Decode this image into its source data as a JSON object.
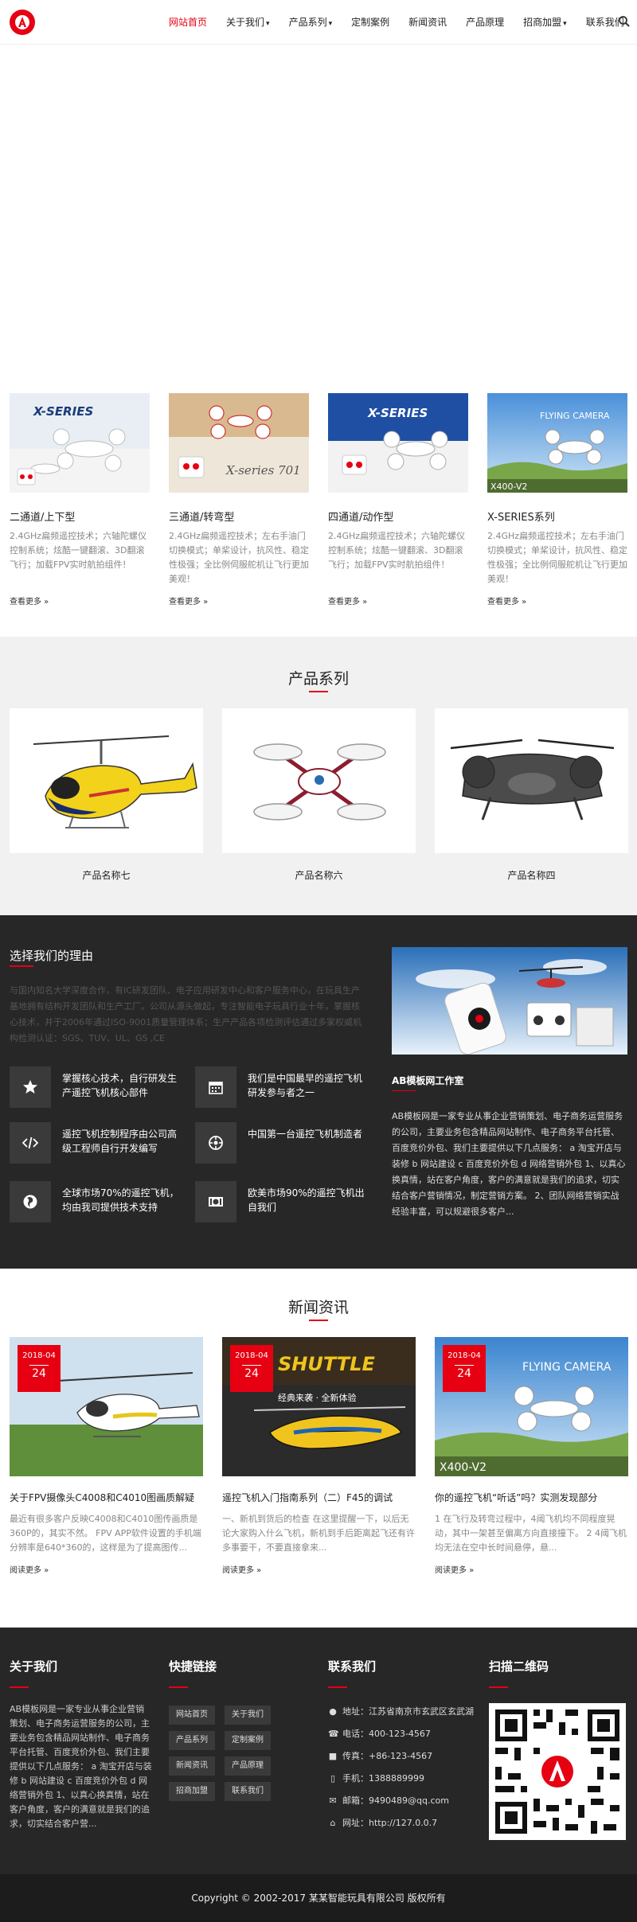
{
  "brand": {
    "logo_letter": "A",
    "accent": "#e60012"
  },
  "nav": {
    "items": [
      {
        "label": "网站首页",
        "active": true,
        "dropdown": false
      },
      {
        "label": "关于我们",
        "active": false,
        "dropdown": true
      },
      {
        "label": "产品系列",
        "active": false,
        "dropdown": true
      },
      {
        "label": "定制案例",
        "active": false,
        "dropdown": false
      },
      {
        "label": "新闻资讯",
        "active": false,
        "dropdown": false
      },
      {
        "label": "产品原理",
        "active": false,
        "dropdown": false
      },
      {
        "label": "招商加盟",
        "active": false,
        "dropdown": true
      },
      {
        "label": "联系我们",
        "active": false,
        "dropdown": false
      }
    ],
    "dropdown_caret": "▾"
  },
  "features": [
    {
      "title": "二通道/上下型",
      "desc": "2.4GHz扁频遥控技术；六轴陀螺仪控制系统；炫酷一键翻滚、3D翻滚飞行；加载FPV实时航拍组件！",
      "more": "查看更多 »",
      "img_text": "X-SERIES"
    },
    {
      "title": "三通道/转弯型",
      "desc": "2.4GHz扁频遥控技术；左右手油门切换模式；单桨设计，抗风性、稳定性极强；全比例伺服舵机让飞行更加美观！",
      "more": "查看更多 »",
      "img_text": "X-series 701"
    },
    {
      "title": "四通道/动作型",
      "desc": "2.4GHz扁频遥控技术；六轴陀螺仪控制系统；炫酷一键翻滚、3D翻滚飞行；加载FPV实时航拍组件！",
      "more": "查看更多 »",
      "img_text": "X-SERIES"
    },
    {
      "title": "X-SERIES系列",
      "desc": "2.4GHz扁频遥控技术；左右手油门切换模式；单桨设计，抗风性、稳定性极强；全比例伺服舵机让飞行更加美观！",
      "more": "查看更多 »",
      "img_text": "FLYING CAMERA",
      "img_text2": "X400-V2"
    }
  ],
  "products": {
    "title": "产品系列",
    "items": [
      {
        "name": "产品名称七"
      },
      {
        "name": "产品名称六"
      },
      {
        "name": "产品名称四"
      }
    ]
  },
  "why": {
    "title": "选择我们的理由",
    "desc": "与国内知名大学深度合作，有IC研发团队、电子应用研发中心和客户服务中心，在玩具生产基地拥有结构开发团队和生产工厂。公司从源头做起，专注智能电子玩具行业十年，掌握核心技术，并于2006年通过ISO-9001质量管理体系；生产产品各项检测评估通过多家权威机构检测认证：SGS、TUV、UL、GS ,CE",
    "items": [
      {
        "text": "掌握核心技术，自行研发生产遥控飞机核心部件",
        "icon": "star-icon"
      },
      {
        "text": "我们是中国最早的遥控飞机研发参与者之一",
        "icon": "calendar-icon"
      },
      {
        "text": "遥控飞机控制程序由公司高级工程师自行开发编写",
        "icon": "code-icon"
      },
      {
        "text": "中国第一台遥控飞机制造者",
        "icon": "dashboard-icon"
      },
      {
        "text": "全球市场70%的遥控飞机，均由我司提供技术支持",
        "icon": "globe-icon"
      },
      {
        "text": "欧美市场90%的遥控飞机出自我们",
        "icon": "money-icon"
      }
    ],
    "studio_title": "AB模板网工作室",
    "studio_desc": "AB模板网是一家专业从事企业营销策划、电子商务运营服务的公司，主要业务包含精品网站制作、电子商务平台托管、百度竞价外包、我们主要提供以下几点服务： a 淘宝开店与装修 b 网站建设 c 百度竞价外包 d 网络营销外包 1、以真心换真情，站在客户角度，客户的满意就是我们的追求，切实结合客户营销情况，制定营销方案。 2、团队网络营销实战经验丰富，可以规避很多客户..."
  },
  "news": {
    "title": "新闻资讯",
    "items": [
      {
        "date_top": "2018-04",
        "date_day": "24",
        "title": "关于FPV摄像头C4008和C4010图画质解疑",
        "desc": "最近有很多客户反映C4008和C4010图传画质是360P的，其实不然。 FPV APP软件设置的手机端分辨率是640*360的，这样是为了提高图传...",
        "more": "阅读更多 »"
      },
      {
        "date_top": "2018-04",
        "date_day": "24",
        "title": "遥控飞机入门指南系列（二）F45的调试",
        "desc": "一、新机到货后的检查 在这里提醒一下，以后无论大家购入什么飞机，新机到手后距离起飞还有许多事要干，不要直接拿来...",
        "more": "阅读更多 »",
        "img_text": "SHUTTLE",
        "img_text2": "经典来袭 · 全新体验"
      },
      {
        "date_top": "2018-04",
        "date_day": "24",
        "title": "你的遥控飞机“听话”吗？实测发现部分",
        "desc": "1 在飞行及转弯过程中，4阈飞机均不同程度晃动，其中一架甚至偏离方向直接撞下。 2 4阈飞机均无法在空中长时间悬停，悬...",
        "more": "阅读更多 »",
        "img_text": "FLYING CAMERA",
        "img_text2": "X400-V2"
      }
    ]
  },
  "footer": {
    "about_title": "关于我们",
    "about_desc": "AB模板网是一家专业从事企业营销策划、电子商务运营服务的公司，主要业务包含精品网站制作、电子商务平台托管、百度竞价外包、我们主要提供以下几点服务： a 淘宝开店与装修 b 网站建设 c 百度竞价外包 d 网络营销外包 1、以真心换真情，站在客户角度，客户的满意就是我们的追求，切实结合客户营...",
    "links_title": "快捷链接",
    "links": [
      "网站首页",
      "关于我们",
      "产品系列",
      "定制案例",
      "新闻资讯",
      "产品原理",
      "招商加盟",
      "联系我们"
    ],
    "contact_title": "联系我们",
    "contact": [
      {
        "icon": "map-marker-icon",
        "text": "地址：江苏省南京市玄武区玄武湖"
      },
      {
        "icon": "phone-icon",
        "text": "电话：400-123-4567"
      },
      {
        "icon": "fax-icon",
        "text": "传真：+86-123-4567"
      },
      {
        "icon": "mobile-icon",
        "text": "手机：1388889999"
      },
      {
        "icon": "mail-icon",
        "text": "邮箱：9490489@qq.com"
      },
      {
        "icon": "home-icon",
        "text": "网址：http://127.0.0.7"
      }
    ],
    "qr_title": "扫描二维码",
    "copyright": "Copyright © 2002-2017 某某智能玩具有限公司 版权所有"
  }
}
